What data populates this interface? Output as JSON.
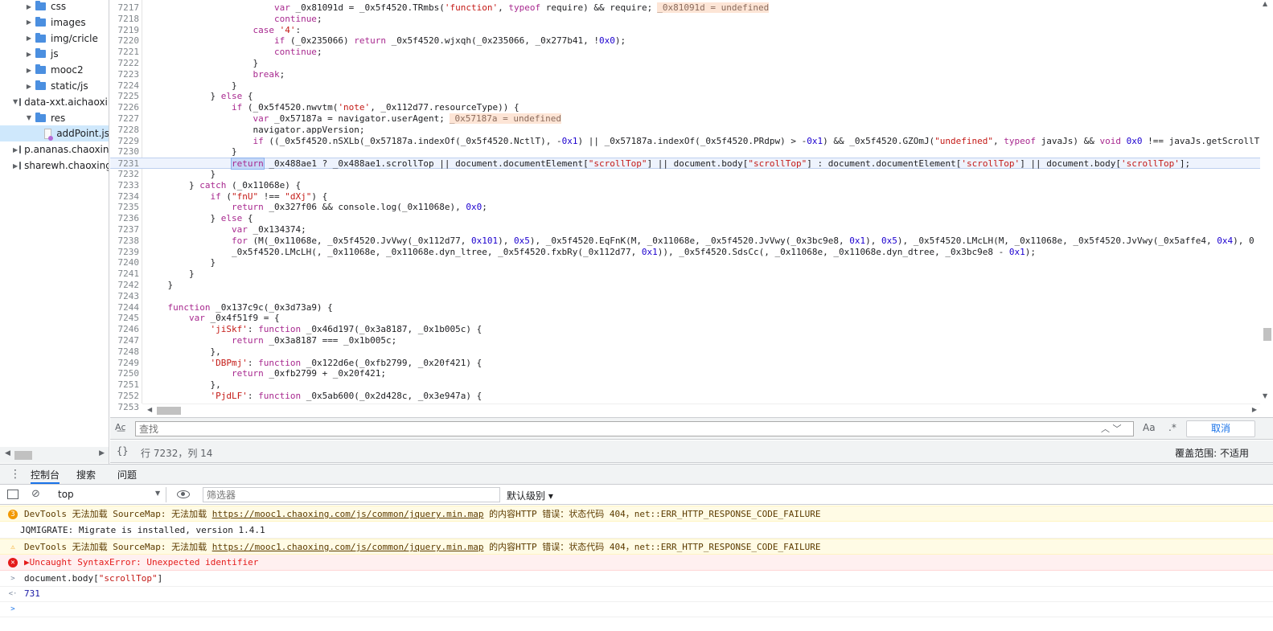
{
  "navigator": {
    "items": [
      {
        "label": "css",
        "type": "folder",
        "indent": 2
      },
      {
        "label": "images",
        "type": "folder",
        "indent": 2
      },
      {
        "label": "img/cricle",
        "type": "folder",
        "indent": 2
      },
      {
        "label": "js",
        "type": "folder",
        "indent": 2
      },
      {
        "label": "mooc2",
        "type": "folder",
        "indent": 2
      },
      {
        "label": "static/js",
        "type": "folder",
        "indent": 2
      },
      {
        "label": "data-xxt.aichaoxing.com",
        "type": "domain",
        "indent": 1,
        "expanded": true
      },
      {
        "label": "res",
        "type": "folder",
        "indent": 2,
        "expanded": true
      },
      {
        "label": "addPoint.js",
        "type": "file",
        "indent": 3,
        "selected": true
      },
      {
        "label": "p.ananas.chaoxing.com",
        "type": "domain",
        "indent": 1
      },
      {
        "label": "sharewh.chaoxing.com",
        "type": "domain",
        "indent": 1
      }
    ]
  },
  "editor": {
    "highlighted_line": 7231,
    "lines": [
      {
        "n": "7217",
        "code": "                        var _0x81091d = _0x5f4520.TRmbs('function', typeof require) && require;",
        "inline": "_0x81091d = undefined"
      },
      {
        "n": "7218",
        "code": "                        continue;"
      },
      {
        "n": "7219",
        "code": "                    case '4':"
      },
      {
        "n": "7220",
        "code": "                        if (_0x235066) return _0x5f4520.wjxqh(_0x235066, _0x277b41, !0x0);"
      },
      {
        "n": "7221",
        "code": "                        continue;"
      },
      {
        "n": "7222",
        "code": "                    }"
      },
      {
        "n": "7223",
        "code": "                    break;"
      },
      {
        "n": "7224",
        "code": "                }"
      },
      {
        "n": "7225",
        "code": "            } else {"
      },
      {
        "n": "7226",
        "code": "                if (_0x5f4520.nwvtm('note', _0x112d77.resourceType)) {"
      },
      {
        "n": "7227",
        "code": "                    var _0x57187a = navigator.userAgent;",
        "inline": "_0x57187a = undefined"
      },
      {
        "n": "7228",
        "code": "                    navigator.appVersion;"
      },
      {
        "n": "7229",
        "code": "                    if ((_0x5f4520.nSXLb(_0x57187a.indexOf(_0x5f4520.NctlT), -0x1) || _0x57187a.indexOf(_0x5f4520.PRdpw) > -0x1) && _0x5f4520.GZOmJ(\"undefined\", typeof javaJs) && void 0x0 !== javaJs.getScrollT"
      },
      {
        "n": "7230",
        "code": "                }"
      },
      {
        "n": "7231",
        "code": "                return _0x488ae1 ? _0x488ae1.scrollTop || document.documentElement[\"scrollTop\"] || document.body[\"scrollTop\"] : document.documentElement['scrollTop'] || document.body['scrollTop'];"
      },
      {
        "n": "7232",
        "code": "            }"
      },
      {
        "n": "7233",
        "code": "        } catch (_0x11068e) {"
      },
      {
        "n": "7234",
        "code": "            if (\"fnU\" !== \"dXj\") {"
      },
      {
        "n": "7235",
        "code": "                return _0x327f06 && console.log(_0x11068e), 0x0;"
      },
      {
        "n": "7236",
        "code": "            } else {"
      },
      {
        "n": "7237",
        "code": "                var _0x134374;"
      },
      {
        "n": "7238",
        "code": "                for (M(_0x11068e, _0x5f4520.JvVwy(_0x112d77, 0x101), 0x5), _0x5f4520.EqFnK(M, _0x11068e, _0x5f4520.JvVwy(_0x3bc9e8, 0x1), 0x5), _0x5f4520.LMcLH(M, _0x11068e, _0x5f4520.JvVwy(_0x5affe4, 0x4), 0x"
      },
      {
        "n": "7239",
        "code": "                _0x5f4520.LMcLH($, _0x11068e, _0x11068e.dyn_ltree, _0x5f4520.fxbRy(_0x112d77, 0x1)), _0x5f4520.SdsCc($, _0x11068e, _0x11068e.dyn_dtree, _0x3bc9e8 - 0x1);"
      },
      {
        "n": "7240",
        "code": "            }"
      },
      {
        "n": "7241",
        "code": "        }"
      },
      {
        "n": "7242",
        "code": "    }"
      },
      {
        "n": "7243",
        "code": ""
      },
      {
        "n": "7244",
        "code": "    function _0x137c9c(_0x3d73a9) {"
      },
      {
        "n": "7245",
        "code": "        var _0x4f51f9 = {"
      },
      {
        "n": "7246",
        "code": "            'jiSkf': function _0x46d197(_0x3a8187, _0x1b005c) {"
      },
      {
        "n": "7247",
        "code": "                return _0x3a8187 === _0x1b005c;"
      },
      {
        "n": "7248",
        "code": "            },"
      },
      {
        "n": "7249",
        "code": "            'DBPmj': function _0x122d6e(_0xfb2799, _0x20f421) {"
      },
      {
        "n": "7250",
        "code": "                return _0xfb2799 + _0x20f421;"
      },
      {
        "n": "7251",
        "code": "            },"
      },
      {
        "n": "7252",
        "code": "            'PjdLF': function _0x5ab600(_0x2d428c, _0x3e947a) {"
      },
      {
        "n": "7253",
        "code": ""
      }
    ]
  },
  "search": {
    "placeholder": "查找",
    "case_label": "Aa",
    "regex_label": ".*",
    "cancel_label": "取消"
  },
  "status": {
    "pretty_print": "{}",
    "cursor": "行 7232，列 14",
    "coverage": "覆盖范围: 不适用"
  },
  "drawer": {
    "tabs": [
      "控制台",
      "搜索",
      "问题"
    ],
    "active_tab": 0
  },
  "console_toolbar": {
    "context": "top",
    "filter_placeholder": "筛选器",
    "levels": "默认级别 ▾"
  },
  "console": {
    "messages": [
      {
        "kind": "warn",
        "badge": "3",
        "prefix": "DevTools 无法加载 SourceMap: 无法加载 ",
        "link": "https://mooc1.chaoxing.com/js/common/jquery.min.map",
        "suffix": " 的内容HTTP 错误：状态代码 404，net::ERR_HTTP_RESPONSE_CODE_FAILURE"
      },
      {
        "kind": "log",
        "text": "JQMIGRATE: Migrate is installed, version 1.4.1"
      },
      {
        "kind": "warn2",
        "prefix": "DevTools 无法加载 SourceMap: 无法加载 ",
        "link": "https://mooc1.chaoxing.com/js/common/jquery.min.map",
        "suffix": " 的内容HTTP 错误：状态代码 404，net::ERR_HTTP_RESPONSE_CODE_FAILURE"
      },
      {
        "kind": "error",
        "text": "▶Uncaught SyntaxError: Unexpected identifier"
      },
      {
        "kind": "input",
        "text": "document.body[\"scrollTop\"]"
      },
      {
        "kind": "result",
        "text": "731"
      },
      {
        "kind": "prompt",
        "text": ""
      }
    ]
  }
}
